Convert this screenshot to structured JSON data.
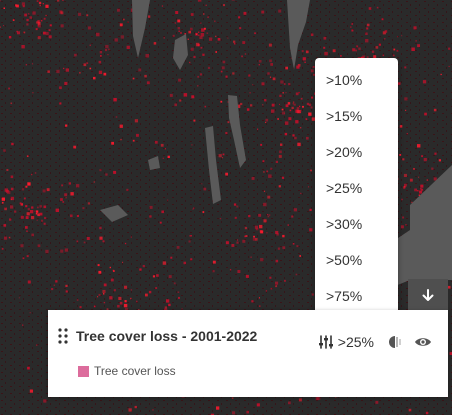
{
  "map": {
    "background": "#2a2a2a",
    "lake_color": "#5a5a5a",
    "loss_color": "#c0102a",
    "loss_bright_color": "#ff1a2e"
  },
  "threshold_dropdown": {
    "options": [
      ">10%",
      ">15%",
      ">20%",
      ">25%",
      ">30%",
      ">50%",
      ">75%"
    ]
  },
  "collapse_button": {
    "icon": "arrow-down-icon"
  },
  "layer_panel": {
    "title": "Tree cover loss - 2001-2022",
    "threshold_value": ">25%",
    "legend_label": "Tree cover loss",
    "legend_color": "#dc6c9c",
    "icons": [
      "drag-handle-icon",
      "sliders-icon",
      "opacity-icon",
      "eye-icon"
    ]
  }
}
